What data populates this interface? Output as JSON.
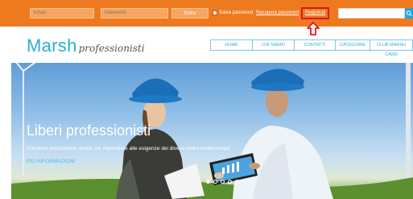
{
  "login": {
    "email_placeholder": "Email",
    "password_placeholder": "Password",
    "enter_label": "Entra",
    "save_password_label": "Salva password",
    "recover_password_label": "Recupera password",
    "register_label": "Registrati"
  },
  "brand": {
    "name": "Marsh",
    "sub": "professionisti"
  },
  "nav": [
    "HOME",
    "CHI SIAMO",
    "CONTATTI",
    "CATEGORIE",
    "CLUB MARSH CARD"
  ],
  "hero": {
    "title": "Liberi professionisti",
    "subtitle": "Soluzioni assicurative ideate per rispondere alle esigenze dei diversi ordini professionali.",
    "more_label": "PIÙ INFORMAZIONI",
    "slides_total": 5,
    "active_slide": 1
  },
  "colors": {
    "topbar": "#ee7a1f",
    "accent": "#2aaed9",
    "highlight": "#e0151b"
  },
  "icons": {
    "search": "search-icon",
    "arrow": "arrow-up-icon"
  }
}
